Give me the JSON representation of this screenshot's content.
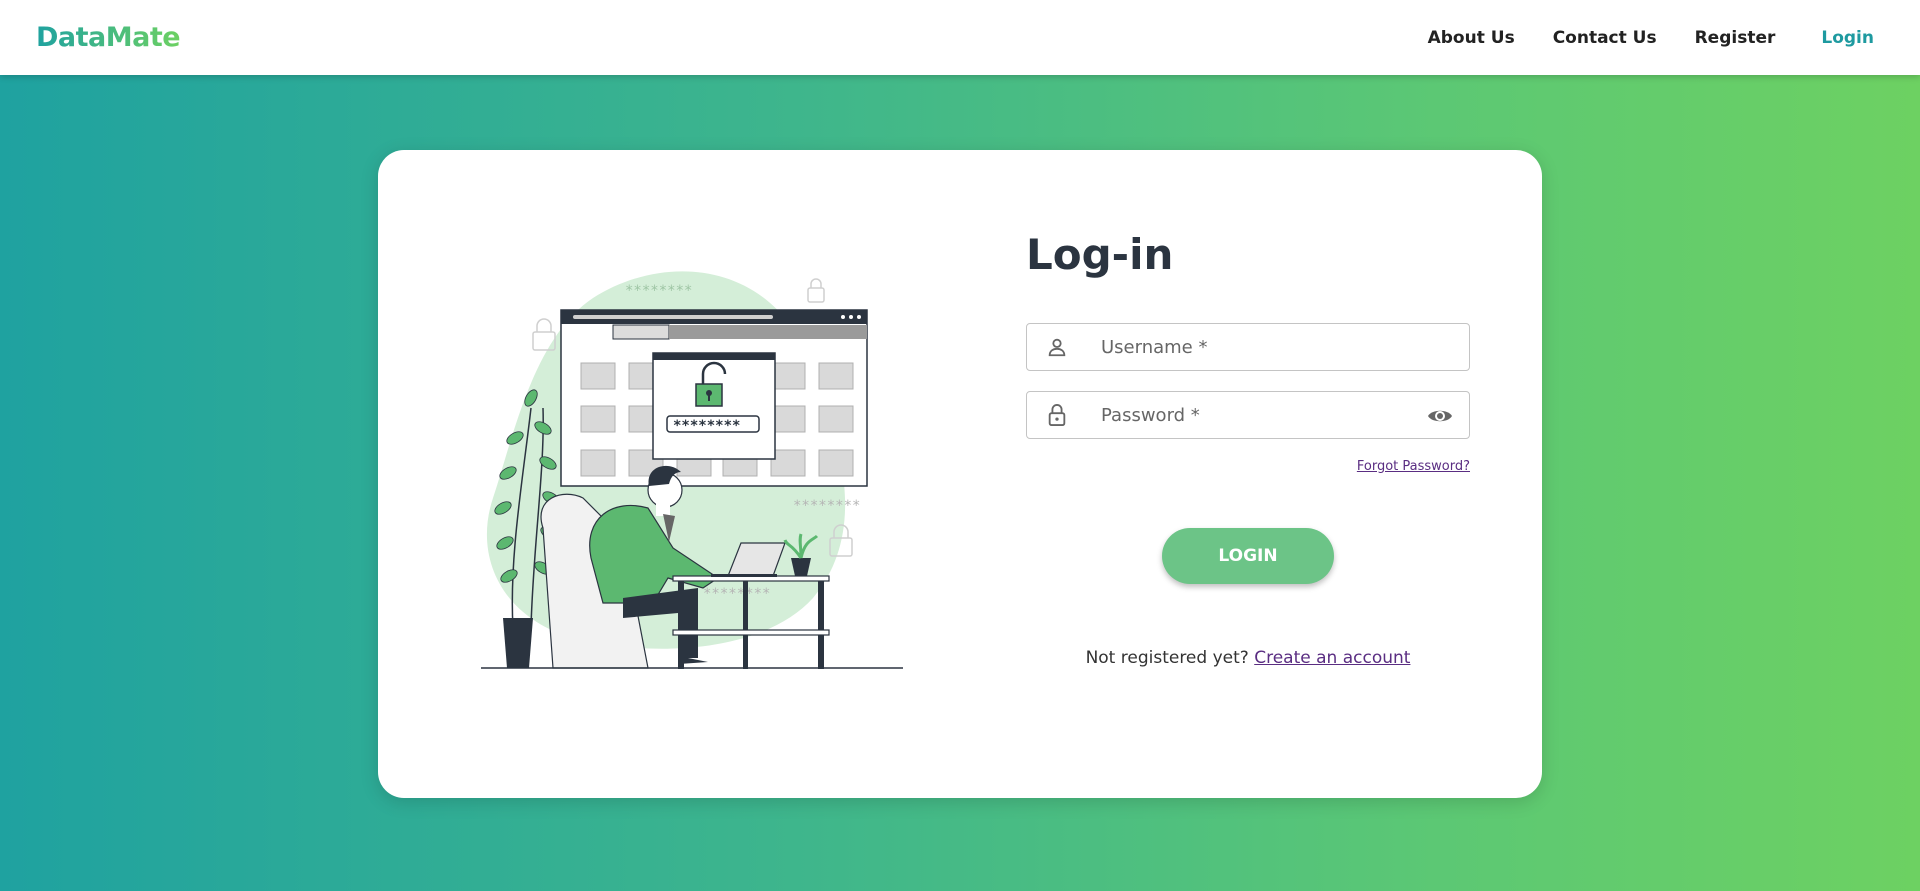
{
  "header": {
    "logo": "DataMate",
    "nav": [
      {
        "label": "About Us"
      },
      {
        "label": "Contact Us"
      },
      {
        "label": "Register"
      },
      {
        "label": "Login",
        "active": true
      }
    ]
  },
  "login": {
    "title": "Log-in",
    "username_placeholder": "Username *",
    "password_placeholder": "Password *",
    "forgot": "Forgot Password?",
    "button": "LOGIN",
    "register_prompt": "Not registered yet?",
    "register_link": "Create an account"
  },
  "illustration": {
    "masked_password": "********",
    "decor_text": "********"
  },
  "colors": {
    "brand_teal": "#1fa2a0",
    "brand_green": "#6dd162",
    "button_green": "#6cc487",
    "link_purple": "#5a2d82",
    "active_nav": "#1e9aa0"
  }
}
